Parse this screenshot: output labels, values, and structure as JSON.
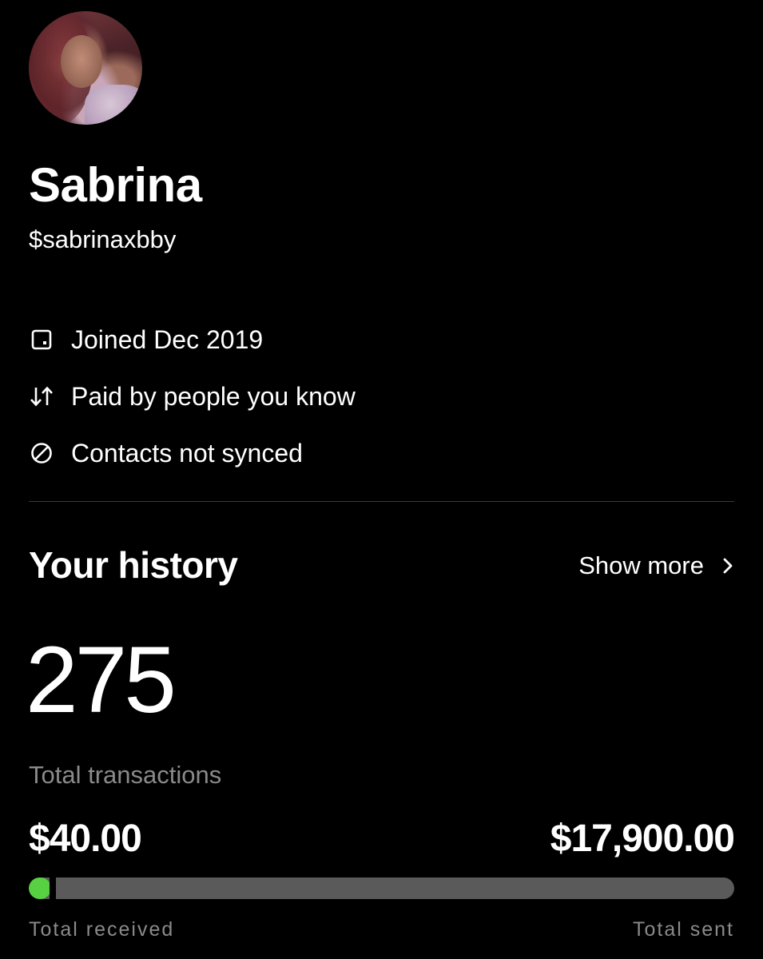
{
  "profile": {
    "name": "Sabrina",
    "handle": "$sabrinaxbby",
    "avatar_icon": "profile-photo"
  },
  "info": {
    "joined": {
      "icon": "calendar-square-icon",
      "label": "Joined Dec 2019"
    },
    "paid": {
      "icon": "swap-arrows-icon",
      "label": "Paid by people you know"
    },
    "contacts": {
      "icon": "prohibited-icon",
      "label": "Contacts not synced"
    }
  },
  "history": {
    "title": "Your history",
    "show_more_label": "Show more",
    "show_more_icon": "chevron-right-icon",
    "transactions_count": "275",
    "transactions_label": "Total transactions",
    "received_amount": "$40.00",
    "sent_amount": "$17,900.00",
    "received_label": "Total received",
    "sent_label": "Total sent",
    "received_fraction": 0.0022
  },
  "colors": {
    "background": "#000000",
    "text": "#ffffff",
    "muted_text": "#8a8a8a",
    "received_accent": "#57d142",
    "bar_track": "#5a5a5a",
    "divider": "#3a3a3a"
  }
}
